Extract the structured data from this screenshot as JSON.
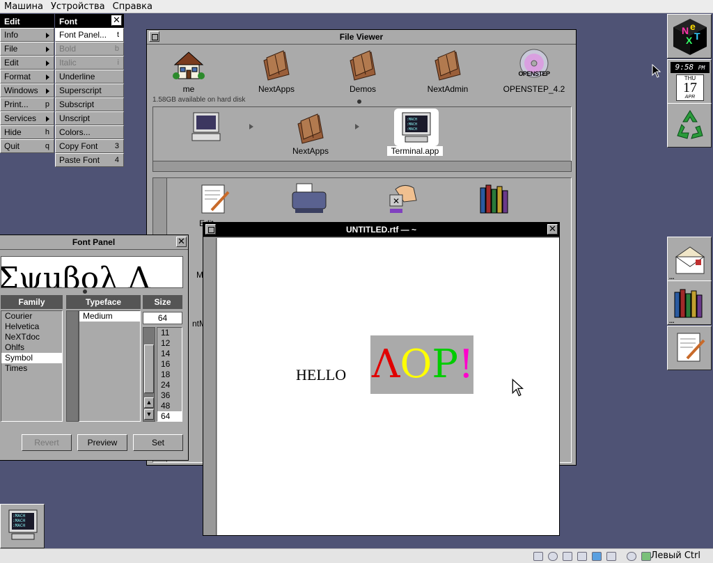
{
  "host": {
    "menu": [
      "Машина",
      "Устройства",
      "Справка"
    ],
    "host_key_label": "Левый Ctrl"
  },
  "edit_menu": {
    "title": "Edit",
    "items": [
      {
        "label": "Info",
        "key": ""
      },
      {
        "label": "File",
        "key": ""
      },
      {
        "label": "Edit",
        "key": ""
      },
      {
        "label": "Format",
        "key": ""
      },
      {
        "label": "Windows",
        "key": ""
      },
      {
        "label": "Print...",
        "key": "p"
      },
      {
        "label": "Services",
        "key": ""
      },
      {
        "label": "Hide",
        "key": "h"
      },
      {
        "label": "Quit",
        "key": "q"
      }
    ]
  },
  "font_menu": {
    "title": "Font",
    "items": [
      {
        "label": "Font Panel...",
        "key": "t"
      },
      {
        "label": "Bold",
        "key": "b"
      },
      {
        "label": "Italic",
        "key": "i"
      },
      {
        "label": "Underline",
        "key": ""
      },
      {
        "label": "Superscript",
        "key": ""
      },
      {
        "label": "Subscript",
        "key": ""
      },
      {
        "label": "Unscript",
        "key": ""
      },
      {
        "label": "Colors...",
        "key": ""
      },
      {
        "label": "Copy Font",
        "key": "3"
      },
      {
        "label": "Paste Font",
        "key": "4"
      }
    ]
  },
  "file_viewer": {
    "title": "File Viewer",
    "shelf": [
      "me",
      "NextApps",
      "Demos",
      "NextAdmin",
      "OPENSTEP_4.2"
    ],
    "disk_info": "1.58GB available on hard disk",
    "browser_path": [
      "NextApps",
      "Terminal.app"
    ],
    "partial_labels": [
      "Edit",
      "FaxReader",
      "Grab",
      "Librarian",
      "M",
      "ntM"
    ]
  },
  "font_panel": {
    "title": "Font Panel",
    "preview_text": "Σψμβολ Λ",
    "family_header": "Family",
    "typeface_header": "Typeface",
    "size_header": "Size",
    "families": [
      "Courier",
      "Helvetica",
      "NeXTdoc",
      "Ohlfs",
      "Symbol",
      "Times"
    ],
    "selected_family": "Symbol",
    "typefaces": [
      "Medium"
    ],
    "size_value": "64",
    "sizes": [
      "11",
      "12",
      "14",
      "16",
      "18",
      "24",
      "36",
      "48",
      "64"
    ],
    "buttons": {
      "revert": "Revert",
      "preview": "Preview",
      "set": "Set"
    }
  },
  "document": {
    "title": "UNTITLED.rtf — ~",
    "hello": "HELLO",
    "symbol_text": "ΛΟΡ!",
    "letter_colors": [
      "#e00000",
      "#ffff00",
      "#00cc00",
      "#ff00cc"
    ]
  },
  "dock": {
    "clock_time": "9:58",
    "clock_ampm": "PM",
    "day": "THU",
    "date": "17",
    "month": "APR"
  },
  "terminal_miniwindow": {
    "screen_lines": [
      ":MACH",
      ":MACH",
      ":MACH"
    ]
  }
}
